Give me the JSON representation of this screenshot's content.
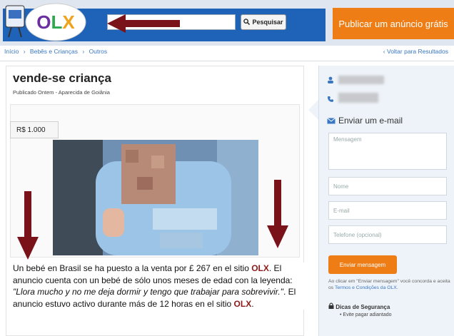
{
  "header": {
    "logo_text": "OLX",
    "search_input_value": "",
    "search_button_label": "Pesquisar",
    "publish_button_label": "Publicar um anúncio grátis"
  },
  "breadcrumb": {
    "items": [
      "Início",
      "›",
      "Bebês e Crianças",
      "›",
      "Outros"
    ],
    "back_label": "‹ Voltar para Resultados"
  },
  "listing": {
    "title": "vende-se criança",
    "subtitle": "Publicado Ontem - Aparecida de Goiânia",
    "price": "R$ 1.000"
  },
  "contact": {
    "send_email_title": "Enviar um e-mail",
    "message_placeholder": "Mensagem",
    "name_placeholder": "Nome",
    "email_placeholder": "E-mail",
    "phone_placeholder": "Telefone (opcional)",
    "send_button_label": "Enviar mensagem",
    "terms_prefix": "Ao clicar em \"Enviar mensagem\" você concorda e aceita os ",
    "terms_link": "Termos e Condições da OLX",
    "terms_suffix": ".",
    "tips_title": "Dicas de Segurança",
    "tip_item": "• Evite pagar adiantado"
  },
  "caption": {
    "part1": "Un bebé en Brasil se ha puesto a la venta por £ 267 en el sitio ",
    "brand1": "OLX",
    "part2": ". El anuncio cuenta con un bebé de sólo unos meses de edad con la leyenda: ",
    "quote": "\"Llora mucho y no me deja dormir y tengo que trabajar para sobrevivir.\"",
    "part3": ". El anuncio estuvo activo durante más de 12 horas en el sitio ",
    "brand2": "OLX",
    "part4": "."
  },
  "colors": {
    "header_blue": "#1f63b8",
    "publish_orange": "#ef7d16",
    "annotation_arrow": "#7a1219",
    "link_blue": "#3a77c2"
  },
  "icons": [
    "search-icon",
    "user-icon",
    "phone-icon",
    "envelope-icon",
    "lock-icon",
    "chevron-left-icon"
  ]
}
